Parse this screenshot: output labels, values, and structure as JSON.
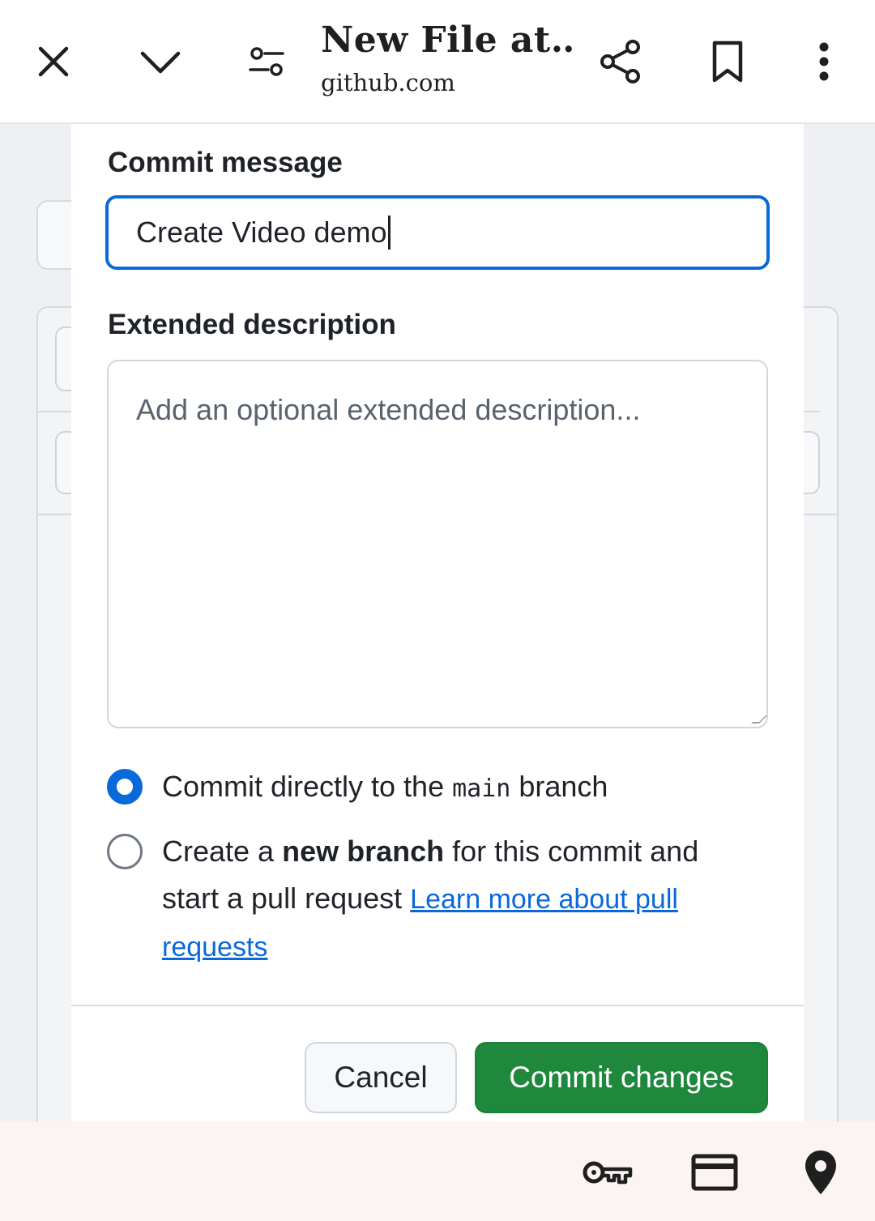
{
  "browser": {
    "title": "New File at…",
    "url": "github.com",
    "icons": [
      "close-icon",
      "chevron-down-icon",
      "page-settings-icon",
      "share-icon",
      "bookmark-icon",
      "more-vert-icon"
    ]
  },
  "dialog": {
    "commit_label": "Commit message",
    "commit_value": "Create Video demo",
    "extended_label": "Extended description",
    "extended_placeholder": "Add an optional extended description...",
    "option_direct": {
      "prefix": "Commit directly to the ",
      "branch": "main",
      "suffix": " branch",
      "selected": true
    },
    "option_new_branch": {
      "prefix": "Create a ",
      "bold": "new branch",
      "middle": " for this commit and start a pull request ",
      "link": "Learn more about pull requests",
      "selected": false
    },
    "cancel_label": "Cancel",
    "commit_label_button": "Commit changes",
    "colors": {
      "accent": "#0969da",
      "commit_button": "#1f883d"
    }
  },
  "autofill_bar": {
    "icons": [
      "key-icon",
      "credit-card-icon",
      "location-pin-icon"
    ]
  }
}
